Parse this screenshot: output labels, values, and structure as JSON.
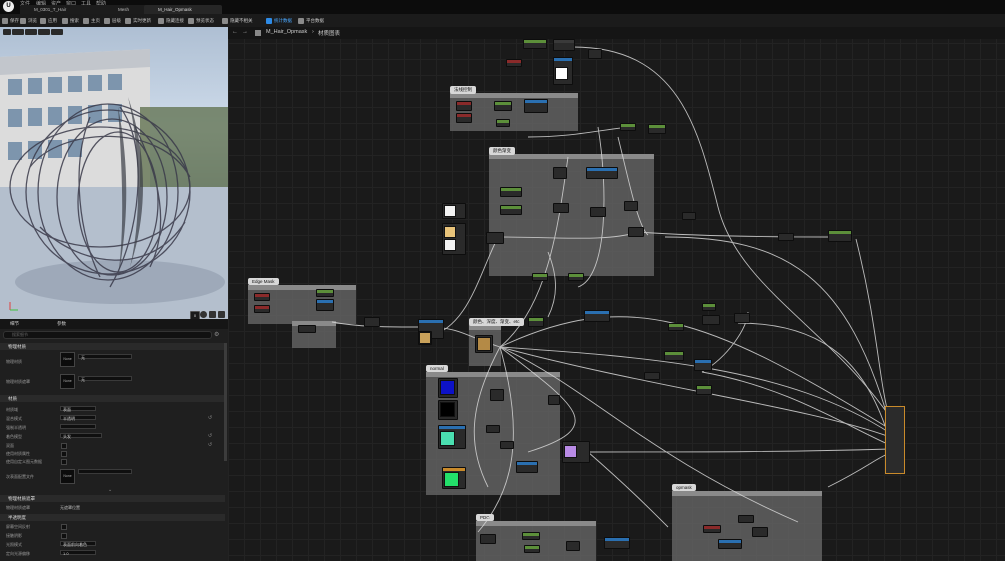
{
  "app": {
    "logo_text": "U"
  },
  "menu": {
    "items": [
      "文件",
      "编辑",
      "资产",
      "窗口",
      "工具",
      "帮助"
    ]
  },
  "tabs": [
    {
      "label": "M_0301_T_Hair"
    },
    {
      "label": "Mesh"
    },
    {
      "label": "M_Hair_Opmask"
    }
  ],
  "toolbar": {
    "buttons": [
      "保存",
      "浏览",
      "应用",
      "搜索",
      "主页",
      "层级",
      "实时更新",
      "隐藏连接",
      "预览状态",
      "隐藏不相关",
      "统计数据",
      "平台数据"
    ]
  },
  "viewport": {
    "badge": "0"
  },
  "breadcrumb": {
    "asset": "M_Hair_Opmask",
    "separator": "›",
    "page": "材质图表"
  },
  "comments": [
    {
      "label": "法线控制"
    },
    {
      "label": "颜色渐变"
    },
    {
      "label": "Edge Mask"
    },
    {
      "label": "颜色、深度、渐变、etc"
    },
    {
      "label": "normal"
    },
    {
      "label": "opmask"
    },
    {
      "label": "PDO"
    }
  ],
  "details": {
    "tabs": [
      "细节",
      "参数"
    ],
    "search_placeholder": "搜索细节",
    "sections": [
      "物理材质",
      "材质",
      "物理材质遮罩",
      "半透明度"
    ],
    "phys_props": [
      "物理材质",
      "物理材质遮罩"
    ],
    "phys_values": [
      "无",
      "无"
    ],
    "thumb_label": "None",
    "mat_props": [
      "材质域",
      "混合模式",
      "强制半透明",
      "着色模型",
      "双面",
      "使用材质属性",
      "使用自定义图元数据",
      "次表面配置文件"
    ],
    "mat_values": [
      "表面",
      "半透明",
      "",
      "头发"
    ],
    "opt_label": "物理材质遮罩",
    "opt_value": "无遮罩位置",
    "trans_props": [
      "屏幕空间反射",
      "接触阴影",
      "光照模式",
      "定向光源偏移"
    ],
    "trans_values": [
      "表面前向着色",
      "1.0"
    ]
  },
  "colors": {
    "accent": "#2e8be6",
    "output_border": "#c98a2a",
    "comment": "#6e6e6e"
  }
}
